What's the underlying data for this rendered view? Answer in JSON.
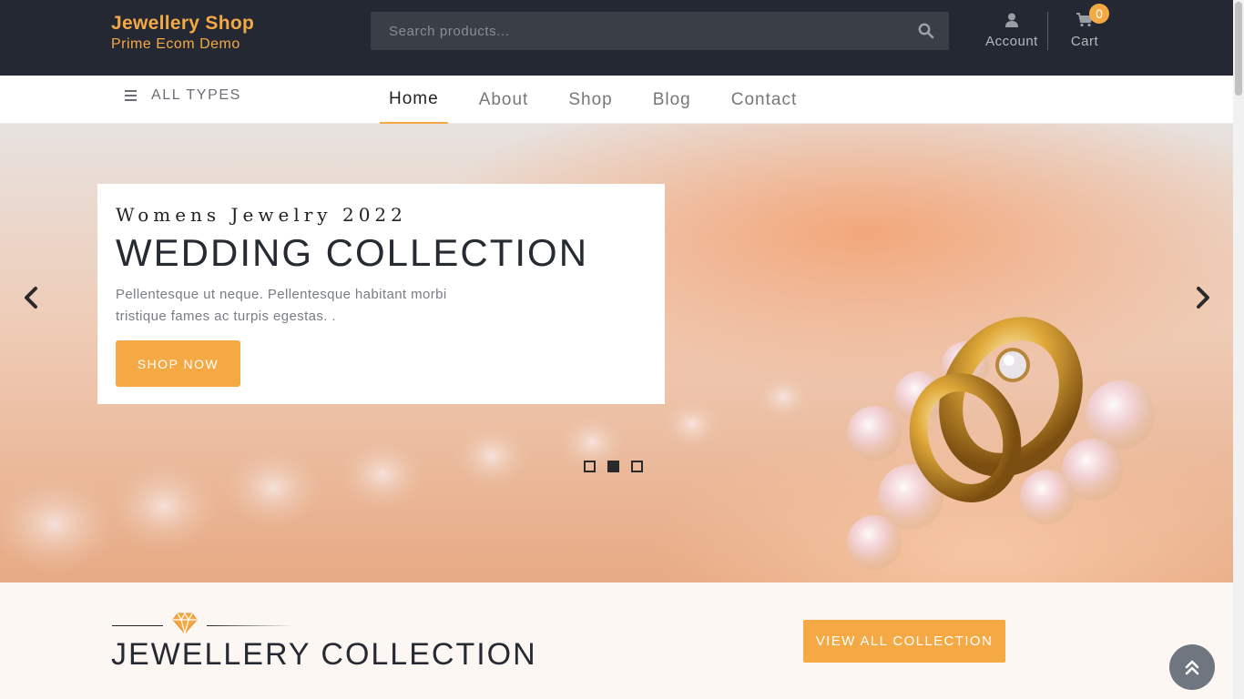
{
  "header": {
    "brand_name": "Jewellery Shop",
    "brand_tagline": "Prime Ecom Demo",
    "search_placeholder": "Search products...",
    "account_label": "Account",
    "cart_label": "Cart",
    "cart_count": "0"
  },
  "nav": {
    "categories_label": "ALL TYPES",
    "items": [
      {
        "label": "Home",
        "active": true
      },
      {
        "label": "About",
        "active": false
      },
      {
        "label": "Shop",
        "active": false
      },
      {
        "label": "Blog",
        "active": false
      },
      {
        "label": "Contact",
        "active": false
      }
    ]
  },
  "hero": {
    "subtitle": "Womens Jewelry 2022",
    "title": "WEDDING COLLECTION",
    "text": "Pellentesque ut neque. Pellentesque habitant morbi tristique fames ac turpis egestas. .",
    "button_label": "SHOP NOW",
    "slides": 3,
    "active_slide": 2
  },
  "collection": {
    "title": "JEWELLERY COLLECTION",
    "button_label": "VIEW ALL COLLECTION"
  },
  "colors": {
    "accent": "#f5a945",
    "header_bg": "#242833",
    "text_dark": "#262a32"
  },
  "icons": [
    "search-icon",
    "user-icon",
    "cart-icon",
    "hamburger-icon",
    "chevron-left-icon",
    "chevron-right-icon",
    "diamond-icon",
    "double-chevron-up-icon"
  ]
}
